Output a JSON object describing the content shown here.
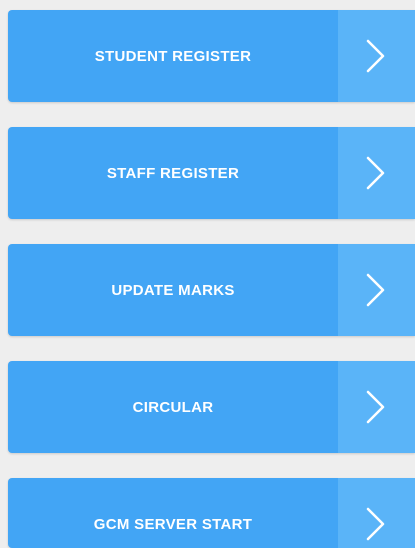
{
  "menu": {
    "items": [
      {
        "label": "STUDENT REGISTER",
        "icon": "chevron-right-icon"
      },
      {
        "label": "STAFF REGISTER",
        "icon": "chevron-right-icon"
      },
      {
        "label": "UPDATE MARKS",
        "icon": "chevron-right-icon"
      },
      {
        "label": "CIRCULAR",
        "icon": "chevron-right-icon"
      },
      {
        "label": "GCM SERVER START",
        "icon": "chevron-right-icon"
      }
    ]
  },
  "colors": {
    "background": "#eeeeee",
    "button": "#42a5f5",
    "arrow_panel": "#5ab4f8",
    "text": "#ffffff"
  }
}
